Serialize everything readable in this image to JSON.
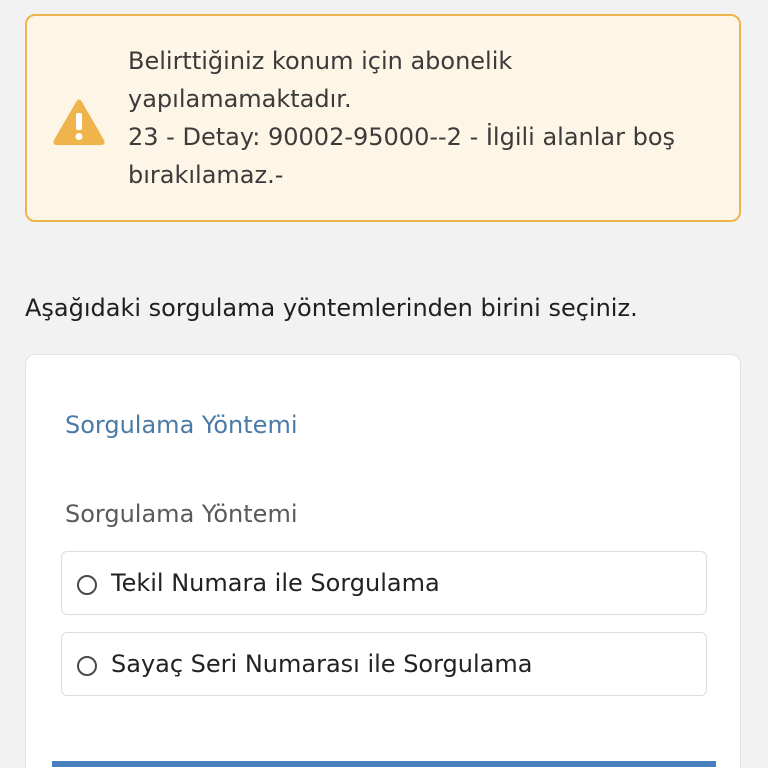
{
  "alert": {
    "icon": "warning-triangle-icon",
    "lines": [
      "Belirttiğiniz konum için abonelik",
      "yapılamamaktadır.",
      "23 - Detay: 90002-95000--2 - İlgili alanlar boş",
      "bırakılamaz.-"
    ],
    "colors": {
      "background": "#fdf5e6",
      "border": "#f0b44c",
      "icon": "#f0b44c"
    }
  },
  "instruction": "Aşağıdaki sorgulama yöntemlerinden birini seçiniz.",
  "form": {
    "section_title": "Sorgulama Yöntemi",
    "field_label": "Sorgulama Yöntemi",
    "options": [
      {
        "label": "Tekil Numara ile Sorgulama",
        "selected": false
      },
      {
        "label": "Sayaç Seri Numarası ile Sorgulama",
        "selected": false
      }
    ],
    "accent_color": "#4a7aa6"
  }
}
